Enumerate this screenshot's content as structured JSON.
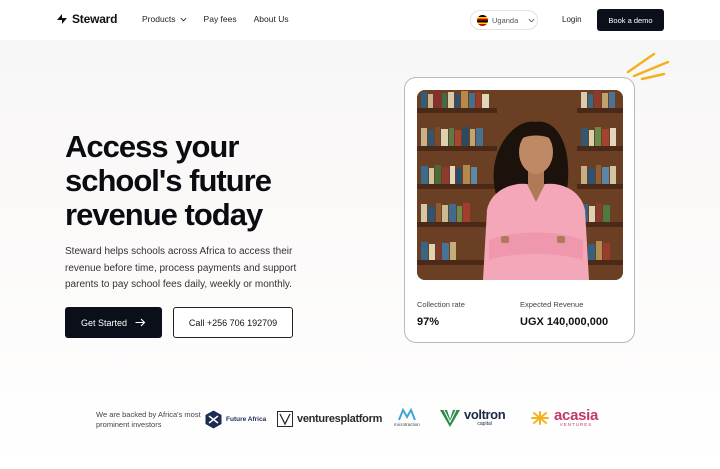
{
  "nav": {
    "brand": "Steward",
    "links": [
      "Products",
      "Pay fees",
      "About Us"
    ],
    "country": "Uganda",
    "login": "Login",
    "cta": "Book a demo"
  },
  "hero": {
    "headline": "Access your school's future revenue today",
    "subtext": "Steward helps schools across Africa to access their revenue before time, process payments and support parents to pay school fees daily, weekly or monthly.",
    "primary_button": "Get Started",
    "secondary_button": "Call +256 706 192709"
  },
  "card": {
    "stat1_label": "Collection rate",
    "stat1_value": "97%",
    "stat2_label": "Expected Revenue",
    "stat2_value": "UGX 140,000,000"
  },
  "backers": {
    "caption": "We are backed by Africa's most prominent investors",
    "future_africa": "Future Africa",
    "ventures_platform": "venturesplatform",
    "microtraction": "microtraction",
    "voltron": "voltron",
    "voltron_sub": "capital",
    "acasia": "acasia",
    "acasia_sub": "VENTURES"
  },
  "colors": {
    "primary_dark": "#0b0f1a",
    "accent_yellow": "#f2b21c",
    "acasia_pink": "#c03a6b"
  }
}
